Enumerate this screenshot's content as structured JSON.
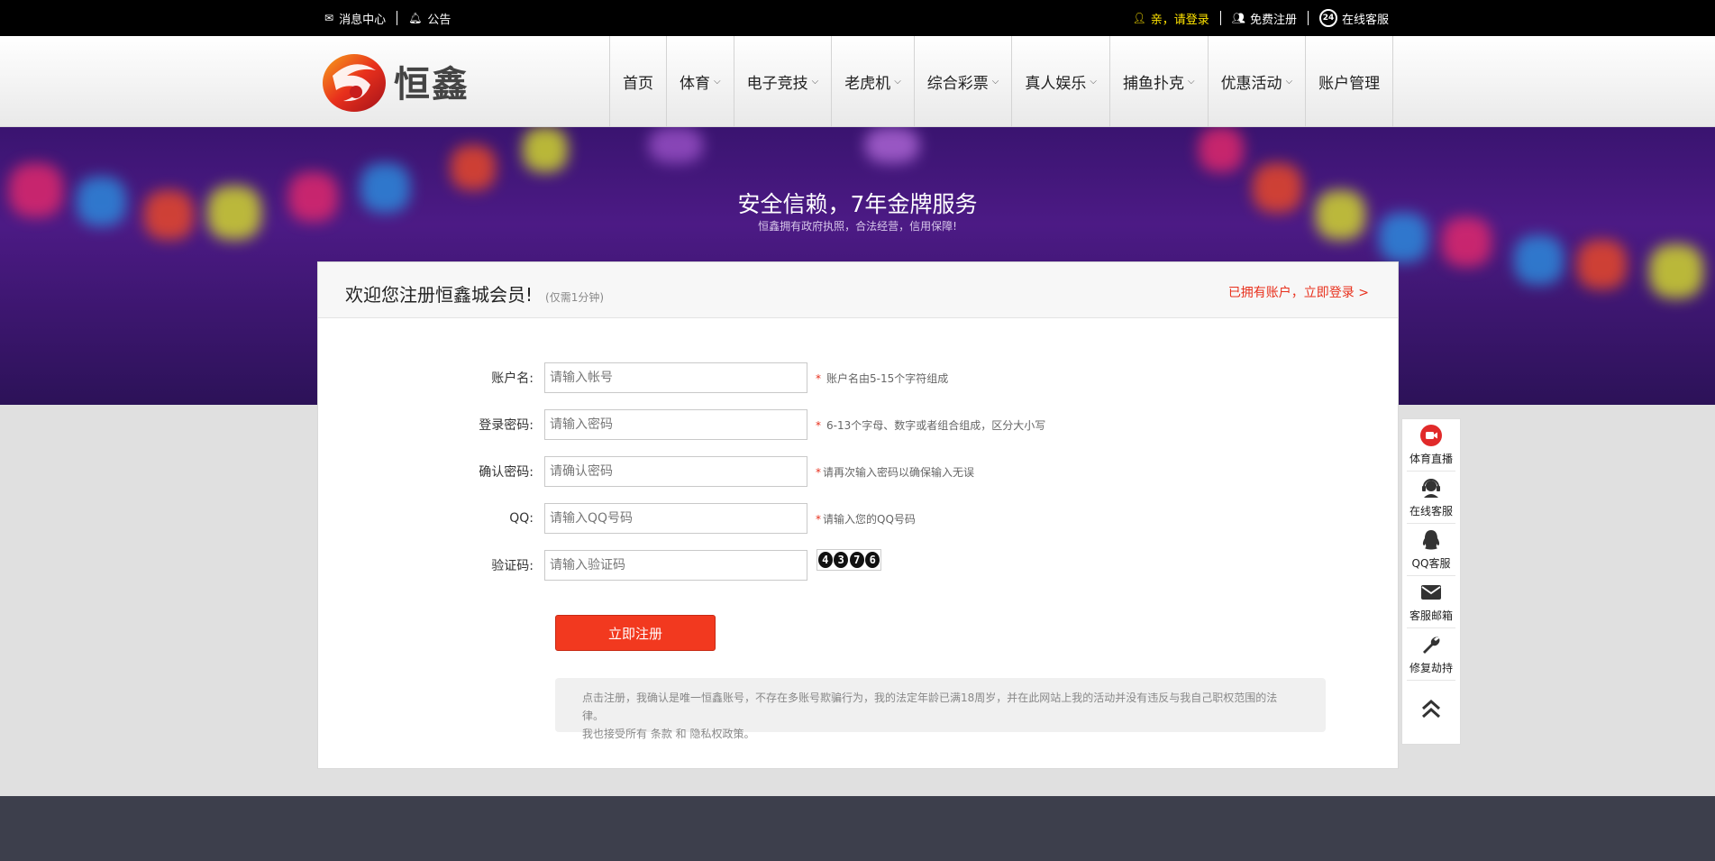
{
  "topbar": {
    "messages": "消息中心",
    "notice": "公告",
    "login": "亲，请登录",
    "register": "免费注册",
    "service": "在线客服"
  },
  "logo": {
    "text": "恒鑫"
  },
  "nav": [
    {
      "label": "首页",
      "dropdown": false
    },
    {
      "label": "体育",
      "dropdown": true
    },
    {
      "label": "电子竞技",
      "dropdown": true
    },
    {
      "label": "老虎机",
      "dropdown": true
    },
    {
      "label": "综合彩票",
      "dropdown": true
    },
    {
      "label": "真人娱乐",
      "dropdown": true
    },
    {
      "label": "捕鱼扑克",
      "dropdown": true
    },
    {
      "label": "优惠活动",
      "dropdown": true
    },
    {
      "label": "账户管理",
      "dropdown": false
    }
  ],
  "banner": {
    "slogan": "安全信赖，7年金牌服务",
    "sub": "恒鑫拥有政府执照，合法经营，信用保障!"
  },
  "card": {
    "title": "欢迎您注册恒鑫城会员!",
    "hint": "(仅需1分钟)",
    "login_link": "已拥有账户，立即登录 >"
  },
  "form": {
    "username": {
      "label": "账户名:",
      "placeholder": "请输入帐号",
      "star": "*",
      "tip": "账户名由5-15个字符组成"
    },
    "password": {
      "label": "登录密码:",
      "placeholder": "请输入密码",
      "star": "*",
      "tip": "6-13个字母、数字或者组合组成，区分大小写"
    },
    "confirm": {
      "label": "确认密码:",
      "placeholder": "请确认密码",
      "star": "*",
      "tip": "请再次输入密码以确保输入无误"
    },
    "qq": {
      "label": "QQ:",
      "placeholder": "请输入QQ号码",
      "star": "*",
      "tip": "请输入您的QQ号码"
    },
    "captcha": {
      "label": "验证码:",
      "placeholder": "请输入验证码",
      "code": [
        "4",
        "3",
        "7",
        "6"
      ]
    }
  },
  "submit_label": "立即注册",
  "agreement": {
    "line1": "点击注册，我确认是唯一恒鑫账号，不存在多账号欺骗行为，我的法定年龄已满18周岁，并在此网站上我的活动并没有违反与我自己职权范围的法律。",
    "line2": "我也接受所有 条款 和 隐私权政策。"
  },
  "side": [
    {
      "label": "体育直播",
      "icon": "live-video-icon"
    },
    {
      "label": "在线客服",
      "icon": "headset-icon"
    },
    {
      "label": "QQ客服",
      "icon": "qq-penguin-icon"
    },
    {
      "label": "客服邮箱",
      "icon": "envelope-icon"
    },
    {
      "label": "修复劫持",
      "icon": "wrench-icon"
    }
  ],
  "colors": {
    "accent": "#f2391f",
    "login_yellow": "#ffe400",
    "banner_purple": "#4c1a85",
    "footer": "#3d3f4c"
  }
}
